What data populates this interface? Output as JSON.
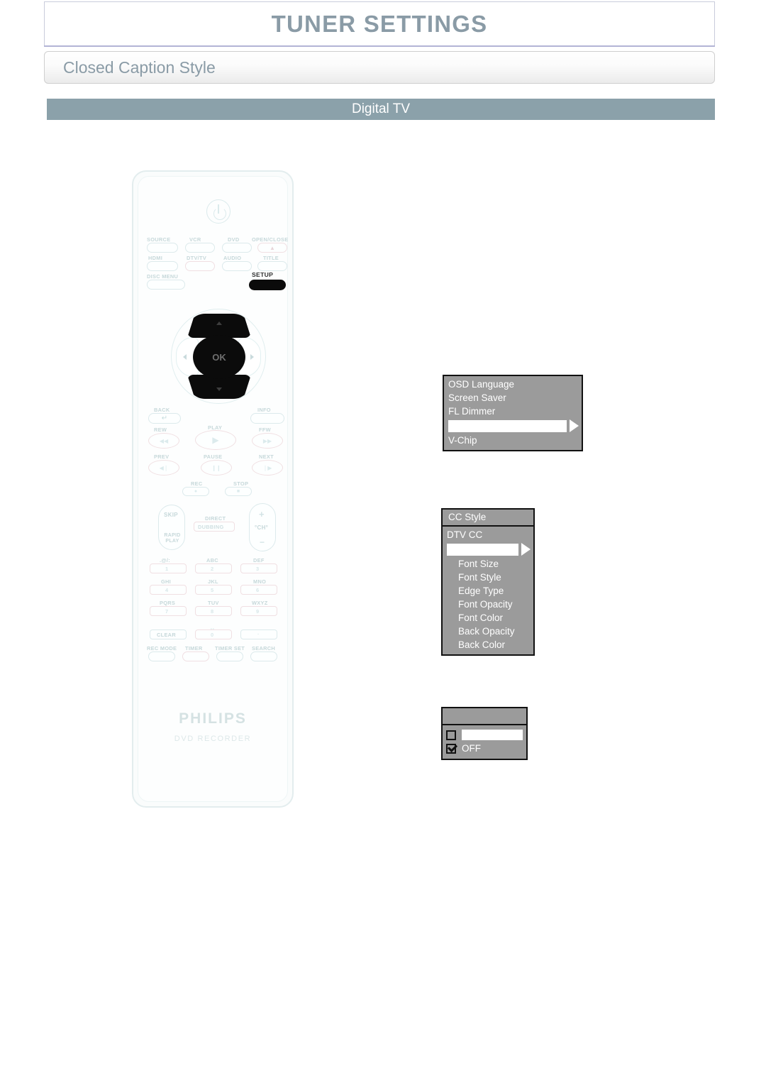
{
  "header": {
    "title": "TUNER SETTINGS"
  },
  "section": {
    "title": "Closed Caption Style"
  },
  "subsection": {
    "title": "Digital TV"
  },
  "colors": {
    "title_slate": "#8a9ba6",
    "bar_slate": "#8ba1aa",
    "header_rule": "#b3b4d6",
    "osd_gray": "#9b9b9b",
    "osd_border": "#111111",
    "highlight_white": "#ffffff",
    "remote_outline": "#dceaec",
    "remote_key_active": "#0b0b0b"
  },
  "remote": {
    "brand": "PHILIPS",
    "model": "DVD RECORDER",
    "power_icon": "power-icon",
    "top_rows": [
      {
        "label": "SOURCE",
        "glyph": ""
      },
      {
        "label": "VCR",
        "glyph": ""
      },
      {
        "label": "DVD",
        "glyph": ""
      },
      {
        "label": "OPEN/CLOSE",
        "glyph": "▲"
      },
      {
        "label": "HDMI",
        "glyph": ""
      },
      {
        "label": "DTV/TV",
        "glyph": ""
      },
      {
        "label": "AUDIO",
        "glyph": ""
      },
      {
        "label": "TITLE",
        "glyph": ""
      },
      {
        "label": "DISC MENU",
        "glyph": ""
      },
      {
        "label": "SETUP",
        "glyph": ""
      }
    ],
    "dpad": {
      "ok_label": "OK",
      "up": "▲",
      "down": "▼",
      "left": "◀",
      "right": "▶"
    },
    "nav_row": [
      {
        "label": "BACK",
        "glyph": "↵"
      },
      {
        "label": "INFO",
        "glyph": ""
      }
    ],
    "transport": [
      {
        "label": "REW",
        "glyph": "◀◀"
      },
      {
        "label": "PLAY",
        "glyph": "▶"
      },
      {
        "label": "FFW",
        "glyph": "▶▶"
      },
      {
        "label": "PREV",
        "glyph": "◀❘"
      },
      {
        "label": "PAUSE",
        "glyph": "❙❙"
      },
      {
        "label": "NEXT",
        "glyph": "❘▶"
      },
      {
        "label": "REC",
        "glyph": "●"
      },
      {
        "label": "STOP",
        "glyph": "■"
      }
    ],
    "skip_key": {
      "top": "SKIP",
      "bottom": "RAPID PLAY"
    },
    "dubbing_key": {
      "top": "DIRECT",
      "label": "DUBBING"
    },
    "channel_key": {
      "plus": "+",
      "label": "°CH°",
      "minus": "−"
    },
    "numeric_keys": [
      {
        "letters": ".@/:",
        "digit": "1"
      },
      {
        "letters": "ABC",
        "digit": "2"
      },
      {
        "letters": "DEF",
        "digit": "3"
      },
      {
        "letters": "GHI",
        "digit": "4"
      },
      {
        "letters": "JKL",
        "digit": "5"
      },
      {
        "letters": "MNO",
        "digit": "6"
      },
      {
        "letters": "PQRS",
        "digit": "7"
      },
      {
        "letters": "TUV",
        "digit": "8"
      },
      {
        "letters": "WXYZ",
        "digit": "9"
      }
    ],
    "bottom_keys": [
      {
        "label": "CLEAR"
      },
      {
        "label": "0",
        "letters": "␣"
      },
      {
        "label": "·"
      }
    ],
    "function_keys": [
      {
        "label": "REC MODE"
      },
      {
        "label": "TIMER"
      },
      {
        "label": "TIMER SET"
      },
      {
        "label": "SEARCH"
      }
    ]
  },
  "osd_menus": [
    {
      "name": "setup-menu",
      "title": "",
      "rows": [
        {
          "text": "OSD Language",
          "type": "item"
        },
        {
          "text": "Screen Saver",
          "type": "item"
        },
        {
          "text": "FL Dimmer",
          "type": "item"
        },
        {
          "text": "",
          "type": "highlight-arrow"
        },
        {
          "text": "V-Chip",
          "type": "item"
        }
      ]
    },
    {
      "name": "cc-style-menu",
      "title": "CC Style",
      "rows": [
        {
          "text": "DTV CC",
          "type": "item"
        },
        {
          "text": "",
          "type": "highlight-arrow"
        },
        {
          "text": "Font Size",
          "type": "item-indent"
        },
        {
          "text": "Font Style",
          "type": "item-indent"
        },
        {
          "text": "Edge Type",
          "type": "item-indent"
        },
        {
          "text": "Font Opacity",
          "type": "item-indent"
        },
        {
          "text": "Font Color",
          "type": "item-indent"
        },
        {
          "text": "Back Opacity",
          "type": "item-indent"
        },
        {
          "text": "Back Color",
          "type": "item-indent"
        }
      ]
    },
    {
      "name": "on-off-menu",
      "title": "",
      "options": [
        {
          "label": "",
          "checked": false,
          "highlighted": true
        },
        {
          "label": "OFF",
          "checked": true,
          "highlighted": false
        }
      ]
    }
  ]
}
